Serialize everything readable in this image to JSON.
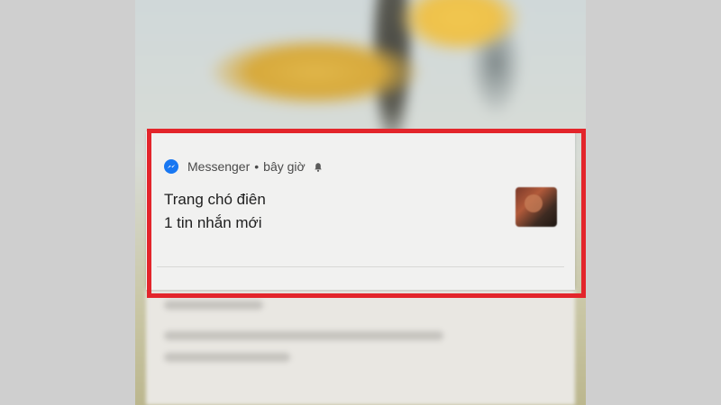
{
  "colors": {
    "highlight": "#e3252b",
    "messenger_blue": "#1877f2",
    "card_bg": "#f1f1f0"
  },
  "notification": {
    "app_icon": "messenger-icon",
    "app_name": "Messenger",
    "separator": "•",
    "time": "bây giờ",
    "bell_icon": "bell-icon",
    "title": "Trang chó điên",
    "text": "1 tin nhắn mới",
    "thumbnail": "contact-avatar-thumbnail"
  }
}
